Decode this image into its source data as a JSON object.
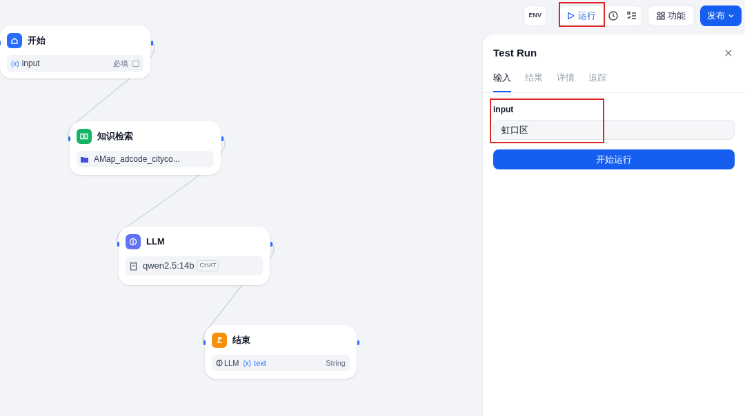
{
  "toolbar": {
    "env_button": "ENV",
    "run_button": {
      "label": "运行",
      "highlighted": true
    },
    "feature_button": "功能",
    "publish_button": "发布"
  },
  "nodes": [
    {
      "kind": "start",
      "title": "开始",
      "rows": [
        {
          "kind": "variable",
          "marker": "(x)",
          "name": "input",
          "required": "必填"
        }
      ]
    },
    {
      "kind": "knowledge",
      "title": "知识检索",
      "rows": [
        {
          "kind": "dataset",
          "name": "AMap_adcode_cityco..."
        }
      ]
    },
    {
      "kind": "llm",
      "title": "LLM",
      "rows": [
        {
          "kind": "model",
          "name": "qwen2.5:14b",
          "tag": "CHAT"
        }
      ]
    },
    {
      "kind": "end",
      "title": "结束",
      "rows": [
        {
          "kind": "output",
          "source": "LLM",
          "marker": "(x)",
          "name": "text",
          "type": "String"
        }
      ]
    }
  ],
  "panel": {
    "title": "Test Run",
    "tabs": [
      {
        "label": "输入",
        "selected": true
      },
      {
        "label": "结果",
        "selected": false
      },
      {
        "label": "详情",
        "selected": false
      },
      {
        "label": "追踪",
        "selected": false
      }
    ],
    "field": {
      "label": "input",
      "value": "虹口区",
      "highlighted": true
    },
    "submit_button": "开始运行"
  }
}
